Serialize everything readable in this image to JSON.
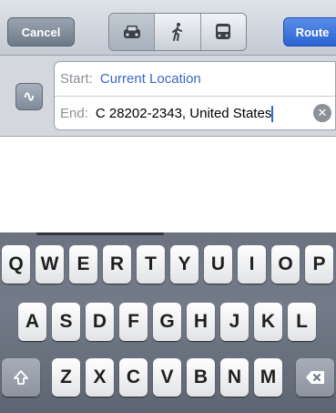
{
  "navbar": {
    "cancel_label": "Cancel",
    "route_label": "Route",
    "modes": [
      {
        "name": "car-icon",
        "selected": true
      },
      {
        "name": "walk-icon",
        "selected": false
      },
      {
        "name": "bus-icon",
        "selected": false
      }
    ]
  },
  "fields": {
    "swap_icon": "swap-icon",
    "start_label": "Start:",
    "start_value": "Current Location",
    "end_label": "End:",
    "end_value": "C  28202-2343, United States",
    "clear_icon": "clear-icon"
  },
  "keyboard": {
    "row1": [
      "Q",
      "W",
      "E",
      "R",
      "T",
      "Y",
      "U",
      "I",
      "O",
      "P"
    ],
    "row2": [
      "A",
      "S",
      "D",
      "F",
      "G",
      "H",
      "J",
      "K",
      "L"
    ],
    "row3": [
      "Z",
      "X",
      "C",
      "V",
      "B",
      "N",
      "M"
    ],
    "shift_icon": "shift-icon",
    "delete_icon": "delete-icon"
  }
}
